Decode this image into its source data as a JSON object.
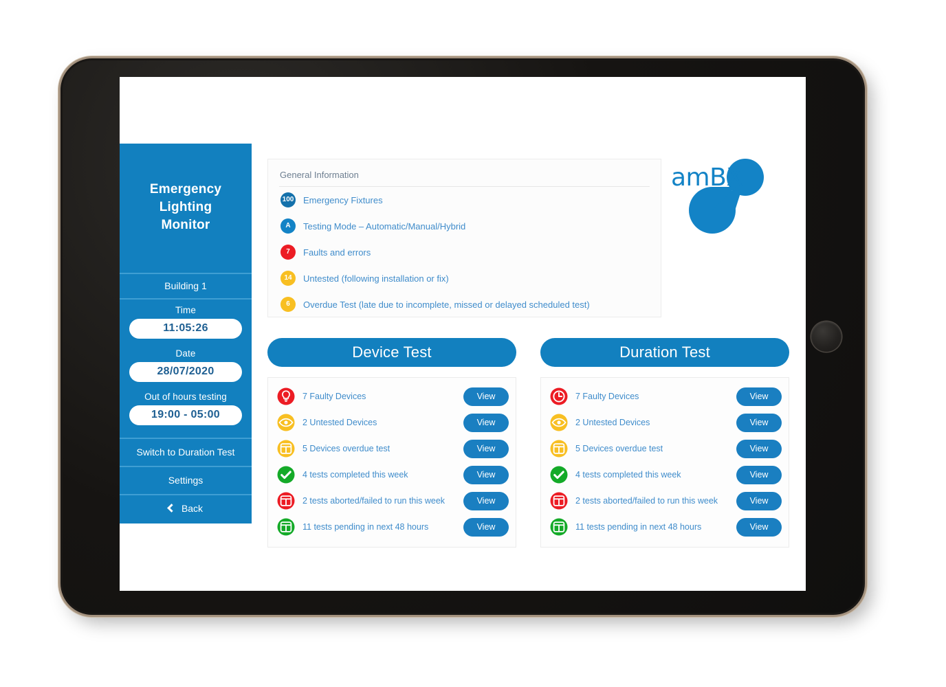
{
  "device": {
    "type": "tablet",
    "home_button": "home-button"
  },
  "sidebar": {
    "title_lines": [
      "Emergency",
      "Lighting",
      "Monitor"
    ],
    "building": "Building 1",
    "time_label": "Time",
    "time_value": "11:05:26",
    "date_label": "Date",
    "date_value": "28/07/2020",
    "out_of_hours_label": "Out of hours testing",
    "out_of_hours_value": "19:00 - 05:00",
    "actions": [
      {
        "label": "Switch to Duration Test",
        "icon": ""
      },
      {
        "label": "Settings",
        "icon": ""
      },
      {
        "label": "Back",
        "icon": "chevron-left-icon"
      }
    ]
  },
  "general_info": {
    "title": "General Information",
    "rows": [
      {
        "badge": "100",
        "color": "#1471ab",
        "label": "Emergency Fixtures"
      },
      {
        "badge": "A",
        "color": "#1383c6",
        "label": "Testing Mode – Automatic/Manual/Hybrid"
      },
      {
        "badge": "7",
        "color": "#ec1c24",
        "label": "Faults and errors"
      },
      {
        "badge": "14",
        "color": "#f8bf22",
        "label": "Untested (following installation or fix)"
      },
      {
        "badge": "6",
        "color": "#f8bf22",
        "label": "Overdue Test (late due to incomplete, missed or delayed scheduled test)"
      }
    ]
  },
  "logo": {
    "text": "amBX",
    "color": "#1383c6"
  },
  "panels": [
    {
      "title": "Device Test",
      "rows": [
        {
          "icon": "bulb-icon",
          "color": "#ec1c24",
          "label": "7 Faulty Devices",
          "action": "View"
        },
        {
          "icon": "eye-icon",
          "color": "#f8bf22",
          "label": "2 Untested Devices",
          "action": "View"
        },
        {
          "icon": "test-icon",
          "color": "#f8bf22",
          "label": "5 Devices overdue test",
          "action": "View"
        },
        {
          "icon": "check-icon",
          "color": "#14aa28",
          "label": "4 tests completed this week",
          "action": "View"
        },
        {
          "icon": "test-icon",
          "color": "#ec1c24",
          "label": "2 tests aborted/failed to run this week",
          "action": "View"
        },
        {
          "icon": "test-icon",
          "color": "#14aa28",
          "label": "11 tests pending in next 48 hours",
          "action": "View"
        }
      ]
    },
    {
      "title": "Duration Test",
      "rows": [
        {
          "icon": "clock-icon",
          "color": "#ec1c24",
          "label": "7 Faulty Devices",
          "action": "View"
        },
        {
          "icon": "eye-icon",
          "color": "#f8bf22",
          "label": "2 Untested Devices",
          "action": "View"
        },
        {
          "icon": "test-icon",
          "color": "#f8bf22",
          "label": "5 Devices overdue test",
          "action": "View"
        },
        {
          "icon": "check-icon",
          "color": "#14aa28",
          "label": "4 tests completed this week",
          "action": "View"
        },
        {
          "icon": "test-icon",
          "color": "#ec1c24",
          "label": "2 tests aborted/failed to run this week",
          "action": "View"
        },
        {
          "icon": "test-icon",
          "color": "#14aa28",
          "label": "11 tests pending in next 48 hours",
          "action": "View"
        }
      ]
    }
  ],
  "colors": {
    "brand_blue": "#1280bf",
    "text_blue": "#3f8ccb",
    "red": "#ec1c24",
    "yellow": "#f8bf22",
    "green": "#14aa28"
  }
}
